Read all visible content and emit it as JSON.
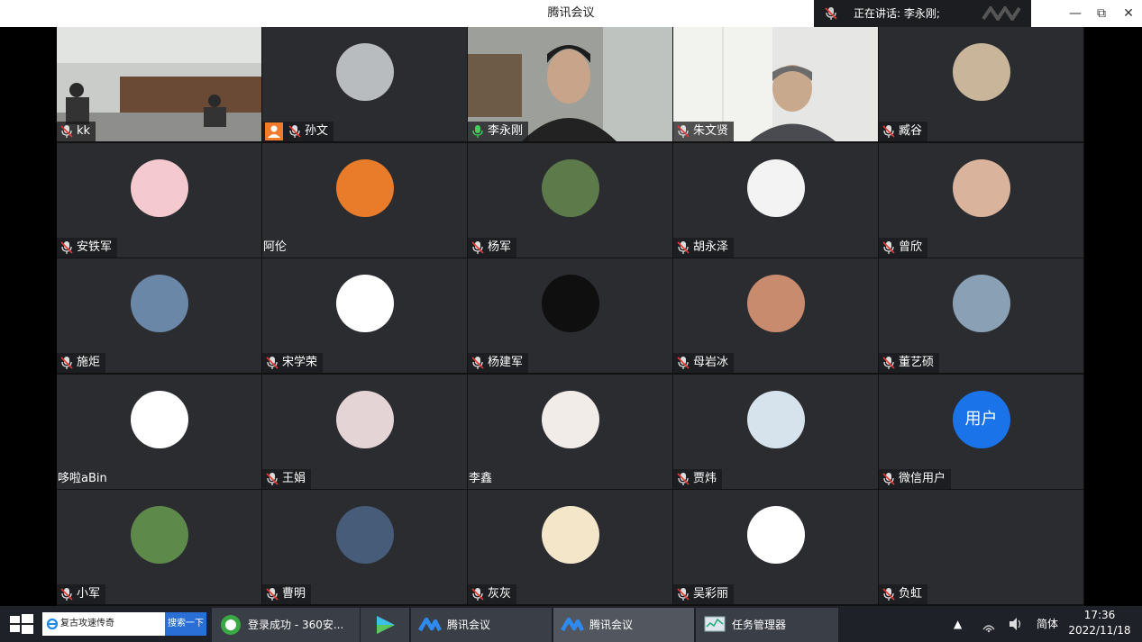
{
  "window": {
    "title": "腾讯会议",
    "speaking_text": "正在讲话: 李永刚;",
    "minimize_label": "—",
    "restore_label": "⧉",
    "close_label": "✕"
  },
  "participants": [
    {
      "name": "kk",
      "mic_off": true,
      "kind": "video1"
    },
    {
      "name": "孙文",
      "mic_off": true,
      "host": true,
      "avatar_color": "#b9bcbf"
    },
    {
      "name": "李永刚",
      "mic_on": true,
      "kind": "video2",
      "active": true
    },
    {
      "name": "朱文贤",
      "mic_off": true,
      "kind": "video3"
    },
    {
      "name": "臧谷",
      "mic_off": true,
      "avatar_color": "#c8b59a"
    },
    {
      "name": "安铁军",
      "mic_off": true,
      "avatar_color": "#f4c9cf"
    },
    {
      "name": "阿伦",
      "mic_off": false,
      "plain": true,
      "avatar_color": "#e97c2a"
    },
    {
      "name": "杨军",
      "mic_off": true,
      "avatar_color": "#5d7a4a"
    },
    {
      "name": "胡永泽",
      "mic_off": true,
      "avatar_color": "#f3f3f3"
    },
    {
      "name": "曾欣",
      "mic_off": true,
      "avatar_color": "#d9b39c"
    },
    {
      "name": "施炬",
      "mic_off": true,
      "avatar_color": "#6a87a8"
    },
    {
      "name": "宋学荣",
      "mic_off": true,
      "avatar_color": "#ffffff"
    },
    {
      "name": "杨建军",
      "mic_off": true,
      "avatar_color": "#0f0f0f"
    },
    {
      "name": "母岩冰",
      "mic_off": true,
      "avatar_color": "#c98b6e"
    },
    {
      "name": "董艺硕",
      "mic_off": true,
      "avatar_color": "#8aa0b4"
    },
    {
      "name": "哆啦aBin",
      "mic_off": false,
      "plain": true,
      "avatar_color": "#ffffff"
    },
    {
      "name": "王娟",
      "mic_off": true,
      "avatar_color": "#e5d4d6"
    },
    {
      "name": "李鑫",
      "mic_off": false,
      "plain": true,
      "avatar_color": "#f2ece8"
    },
    {
      "name": "贾炜",
      "mic_off": true,
      "avatar_color": "#d6e2ec"
    },
    {
      "name": "微信用户",
      "mic_off": true,
      "avatar_color": "#1a73e8",
      "avatar_text": "用户"
    },
    {
      "name": "小军",
      "mic_off": true,
      "avatar_color": "#5d8a4a"
    },
    {
      "name": "曹明",
      "mic_off": true,
      "avatar_color": "#475c78"
    },
    {
      "name": "灰灰",
      "mic_off": true,
      "avatar_color": "#f3e6c9"
    },
    {
      "name": "吴彩丽",
      "mic_off": true,
      "avatar_color": "#ffffff"
    },
    {
      "name": "负虹",
      "mic_off": true,
      "avatar_color": "#2b2c30"
    }
  ],
  "taskbar": {
    "search_text": "复古攻速传奇",
    "search_button": "搜索一下",
    "items": [
      {
        "label": "登录成功 - 360安...",
        "icon": "360-browser-icon"
      },
      {
        "label": "",
        "icon": "video-player-icon"
      },
      {
        "label": "腾讯会议",
        "icon": "tencent-meeting-icon"
      },
      {
        "label": "腾讯会议",
        "icon": "tencent-meeting-icon"
      },
      {
        "label": "任务管理器",
        "icon": "task-manager-icon"
      }
    ],
    "ime": "简体",
    "time": "17:36",
    "date": "2022/11/18"
  }
}
